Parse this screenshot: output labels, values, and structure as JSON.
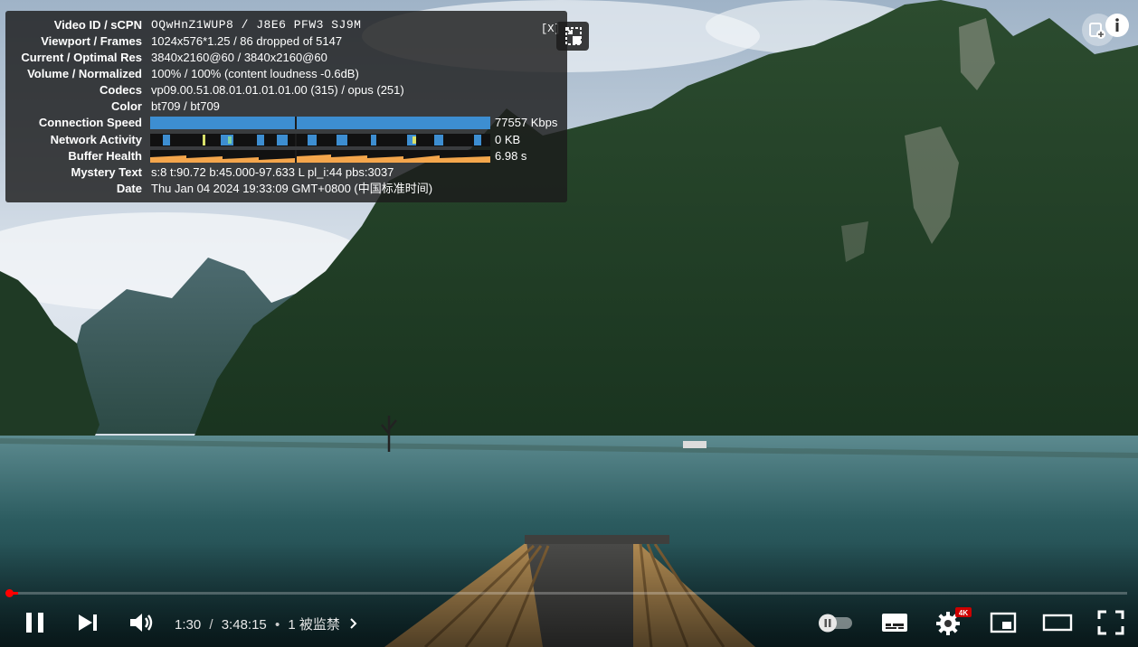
{
  "stats": {
    "close_label": "[X]",
    "rows": [
      {
        "label": "Video ID / sCPN",
        "value": "OQwHnZ1WUP8  /  J8E6 PFW3 SJ9M"
      },
      {
        "label": "Viewport / Frames",
        "value": "1024x576*1.25 / 86 dropped of 5147"
      },
      {
        "label": "Current / Optimal Res",
        "value": "3840x2160@60 / 3840x2160@60"
      },
      {
        "label": "Volume / Normalized",
        "value": "100% / 100% (content loudness -0.6dB)"
      },
      {
        "label": "Codecs",
        "value": "vp09.00.51.08.01.01.01.01.00 (315) / opus (251)"
      },
      {
        "label": "Color",
        "value": "bt709 / bt709"
      },
      {
        "label": "Connection Speed",
        "value": "77557 Kbps"
      },
      {
        "label": "Network Activity",
        "value": "0 KB"
      },
      {
        "label": "Buffer Health",
        "value": "6.98 s"
      },
      {
        "label": "Mystery Text",
        "value": "s:8 t:90.72 b:45.000-97.633 L pl_i:44 pbs:3037"
      },
      {
        "label": "Date",
        "value": "Thu Jan 04 2024 19:33:09 GMT+0800 (中国标准时间)"
      }
    ]
  },
  "controls": {
    "current_time": "1:30",
    "separator": "/",
    "duration": "3:48:15",
    "bullet": "•",
    "chapter": "1 被监禁",
    "progress_fraction": 0.0066,
    "quality_badge": "4K",
    "icons": [
      "pause-icon",
      "next-icon",
      "volume-icon",
      "chevron-right-icon",
      "autoplay-toggle-icon",
      "subtitles-icon",
      "settings-icon",
      "miniplayer-icon",
      "theater-mode-icon",
      "fullscreen-icon"
    ]
  },
  "colors": {
    "progress": "#ff0000",
    "badge": "#cc0000",
    "connection_bar": "#3d8ed1",
    "buffer_bar": "#f4a64c"
  }
}
